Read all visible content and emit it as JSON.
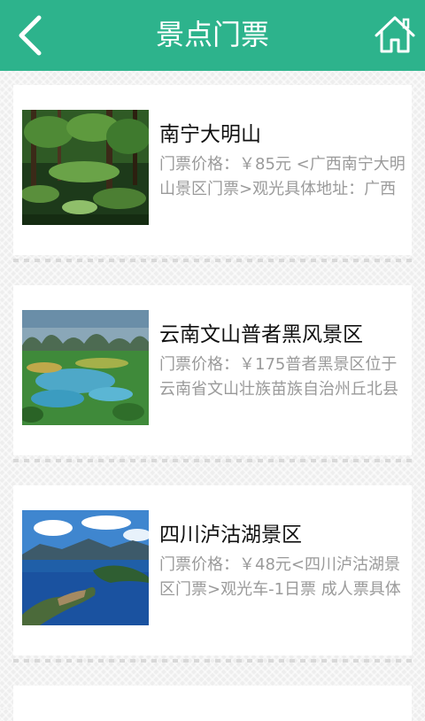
{
  "header": {
    "title": "景点门票",
    "back_icon": "chevron-left-icon",
    "home_icon": "home-icon",
    "color": "#2db38c"
  },
  "spots": [
    {
      "name": "南宁大明山",
      "desc": "门票价格：￥85元 <广西南宁大明山景区门票>观光具体地址：广西",
      "image": "forest-waterfall"
    },
    {
      "name": "云南文山普者黑风景区",
      "desc": "门票价格：￥175普者黑景区位于云南省文山壮族苗族自治州丘北县",
      "image": "karst-lake"
    },
    {
      "name": "四川泸沽湖景区",
      "desc": "门票价格：￥48元<四川泸沽湖景区门票>观光车-1日票 成人票具体",
      "image": "blue-lake-peninsula"
    }
  ]
}
